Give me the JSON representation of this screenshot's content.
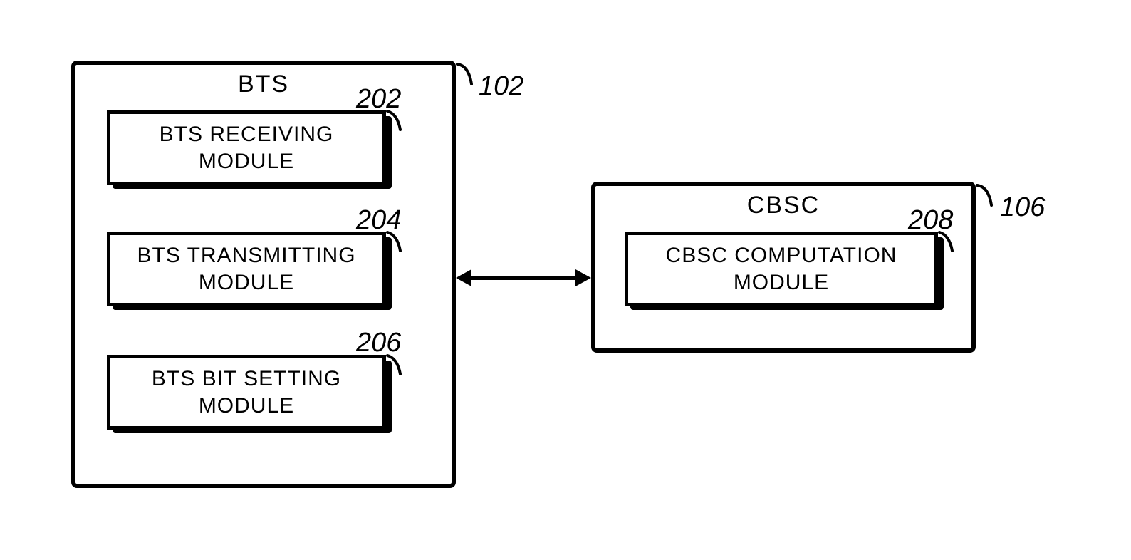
{
  "bts": {
    "title": "BTS",
    "ref": "102",
    "modules": [
      {
        "label": "BTS RECEIVING MODULE",
        "ref": "202"
      },
      {
        "label": "BTS TRANSMITTING MODULE",
        "ref": "204"
      },
      {
        "label": "BTS BIT SETTING MODULE",
        "ref": "206"
      }
    ]
  },
  "cbsc": {
    "title": "CBSC",
    "ref": "106",
    "modules": [
      {
        "label": "CBSC COMPUTATION MODULE",
        "ref": "208"
      }
    ]
  }
}
